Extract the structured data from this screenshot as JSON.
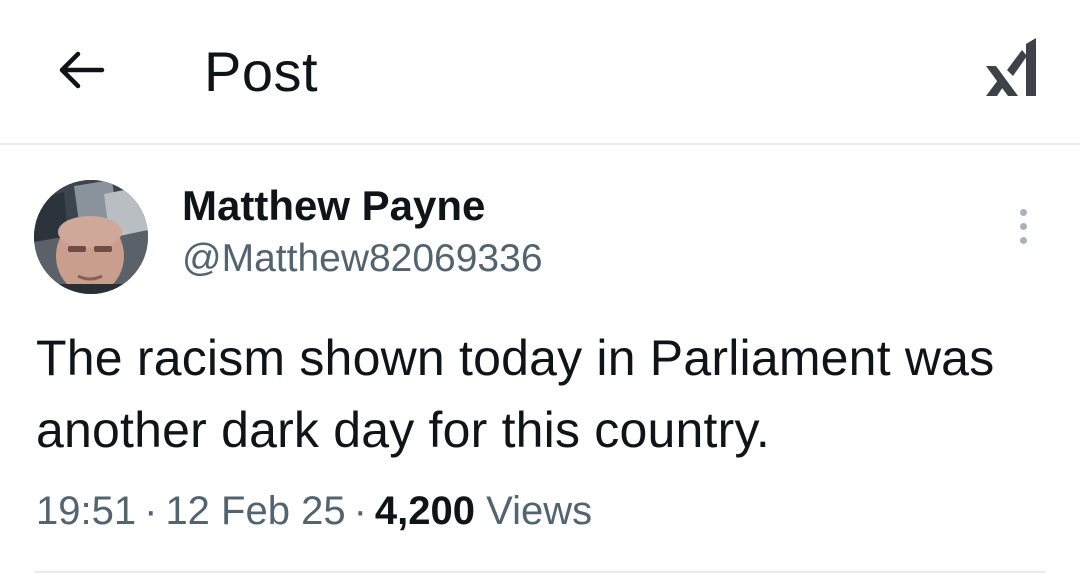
{
  "header": {
    "title": "Post",
    "back_icon": "arrow-left-icon",
    "grok_icon": "grok-icon"
  },
  "post": {
    "author": {
      "name": "Matthew Payne",
      "handle": "@Matthew82069336"
    },
    "more_icon": "more-vertical-icon",
    "text": "The racism shown today in Parliament was another dark day for this country.",
    "time": "19:51",
    "date": "12 Feb 25",
    "separator": "·",
    "views_count": "4,200",
    "views_label": "Views"
  },
  "colors": {
    "text_primary": "#0f1419",
    "text_secondary": "#536471",
    "divider": "#e7ecef"
  }
}
